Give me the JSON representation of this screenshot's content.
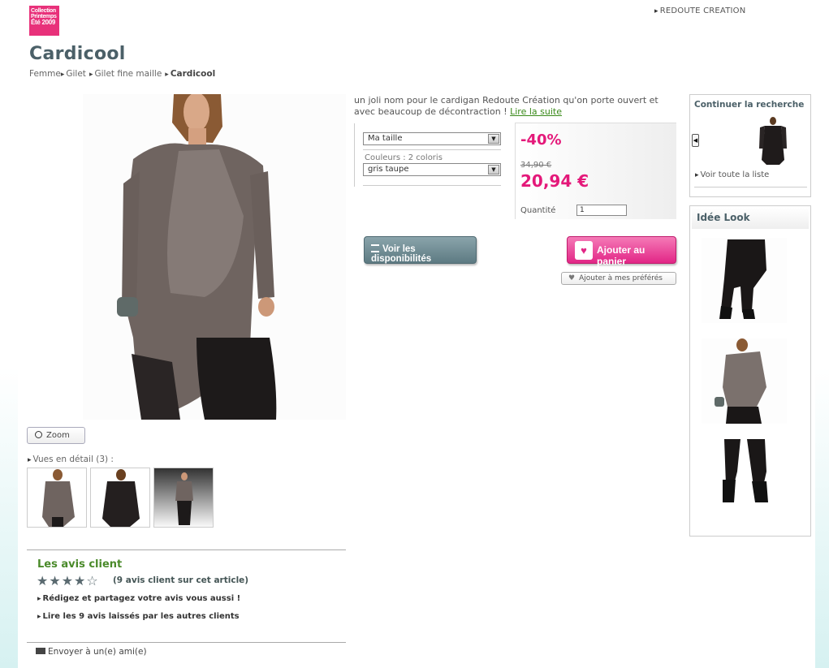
{
  "header": {
    "logo_line1": "Collection",
    "logo_line2": "Printemps",
    "logo_line3": "Été 2009",
    "brand_link": "REDOUTE CREATION"
  },
  "product": {
    "title": "Cardicool",
    "breadcrumb": [
      "Femme",
      "Gilet",
      "Gilet fine maille",
      "Cardicool"
    ],
    "description": "un joli nom pour le cardigan Redoute Création qu'on porte ouvert et avec beaucoup de décontraction !",
    "read_more": "Lire la suite",
    "size_select": "Ma taille",
    "colors_label": "Couleurs : 2 coloris",
    "color_select": "gris taupe",
    "discount": "-40%",
    "old_price": "34,90 €",
    "new_price": "20,94 €",
    "quantity_label": "Quantité",
    "quantity_value": "1"
  },
  "buttons": {
    "zoom": "Zoom",
    "availability": "Voir les disponibilités",
    "add_to_cart": "Ajouter au panier",
    "add_to_favorites": "Ajouter à mes préférés"
  },
  "details": {
    "label": "Vues en détail (3) :"
  },
  "reviews": {
    "title": "Les avis client",
    "rating": 4,
    "rating_max": 5,
    "count_text": "(9 avis client sur cet article)",
    "write_link": "Rédigez et partagez votre avis vous aussi !",
    "read_link": "Lire les 9 avis laissés par les autres clients"
  },
  "share": {
    "send_friend": "Envoyer à un(e) ami(e)"
  },
  "sidebar": {
    "continue_title": "Continuer la recherche",
    "see_list": "Voir toute la liste",
    "idee_title": "Idée Look"
  },
  "colors": {
    "pink": "#e4197a",
    "green": "#4a8a2a",
    "slate": "#4b6068"
  }
}
